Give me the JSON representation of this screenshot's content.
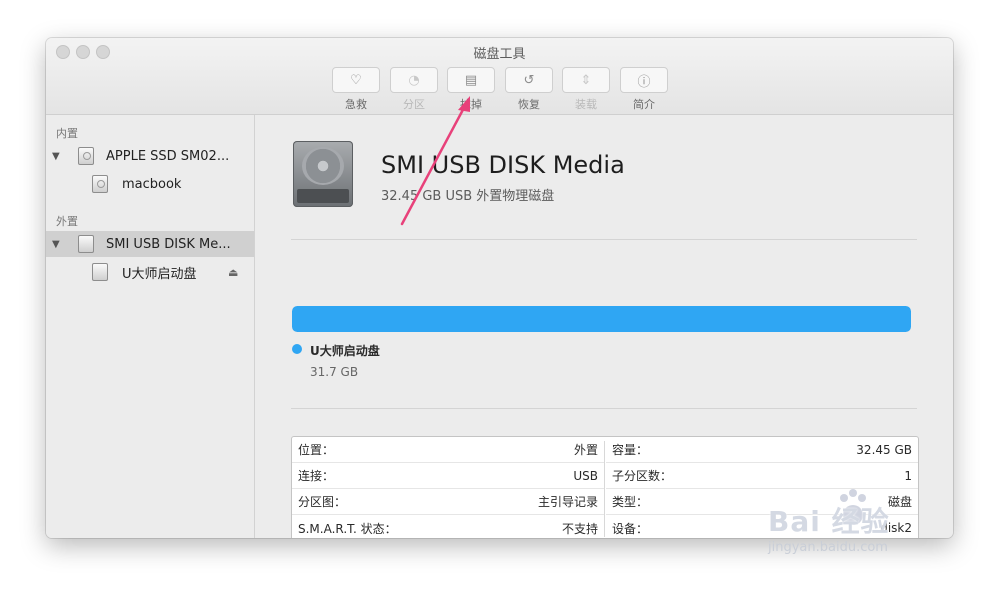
{
  "window": {
    "title": "磁盘工具"
  },
  "toolbar": {
    "items": [
      {
        "label": "急救",
        "icon": "stethoscope-icon",
        "glyph": "♡",
        "enabled": true
      },
      {
        "label": "分区",
        "icon": "partition-icon",
        "glyph": "◔",
        "enabled": false
      },
      {
        "label": "抹掉",
        "icon": "erase-icon",
        "glyph": "▤",
        "enabled": true
      },
      {
        "label": "恢复",
        "icon": "restore-icon",
        "glyph": "↺",
        "enabled": true
      },
      {
        "label": "装载",
        "icon": "mount-icon",
        "glyph": "⇕",
        "enabled": false
      },
      {
        "label": "简介",
        "icon": "info-icon",
        "glyph": "ⓘ",
        "enabled": true
      }
    ]
  },
  "sidebar": {
    "internal_header": "内置",
    "external_header": "外置",
    "items": [
      {
        "label": "APPLE SSD SM02..."
      },
      {
        "label": "macbook"
      },
      {
        "label": "SMI USB DISK Me..."
      },
      {
        "label": "U大师启动盘"
      }
    ],
    "eject_glyph": "⏏"
  },
  "detail": {
    "name": "SMI USB DISK Media",
    "description": "32.45 GB USB 外置物理磁盘",
    "partition": {
      "name": "U大师启动盘",
      "size": "31.7 GB",
      "fill_fraction": 1.0,
      "color": "#2fa6f3"
    },
    "info_left": [
      {
        "label": "位置：",
        "value": "外置"
      },
      {
        "label": "连接：",
        "value": "USB"
      },
      {
        "label": "分区图：",
        "value": "主引导记录"
      },
      {
        "label": "S.M.A.R.T. 状态：",
        "value": "不支持"
      }
    ],
    "info_right": [
      {
        "label": "容量：",
        "value": "32.45 GB"
      },
      {
        "label": "子分区数：",
        "value": "1"
      },
      {
        "label": "类型：",
        "value": "磁盘"
      },
      {
        "label": "设备：",
        "value": "disk2"
      }
    ]
  },
  "watermark": {
    "logo": "Bai  经验",
    "url": "jingyan.baidu.com"
  },
  "annotation": {
    "color": "#e8417a"
  }
}
